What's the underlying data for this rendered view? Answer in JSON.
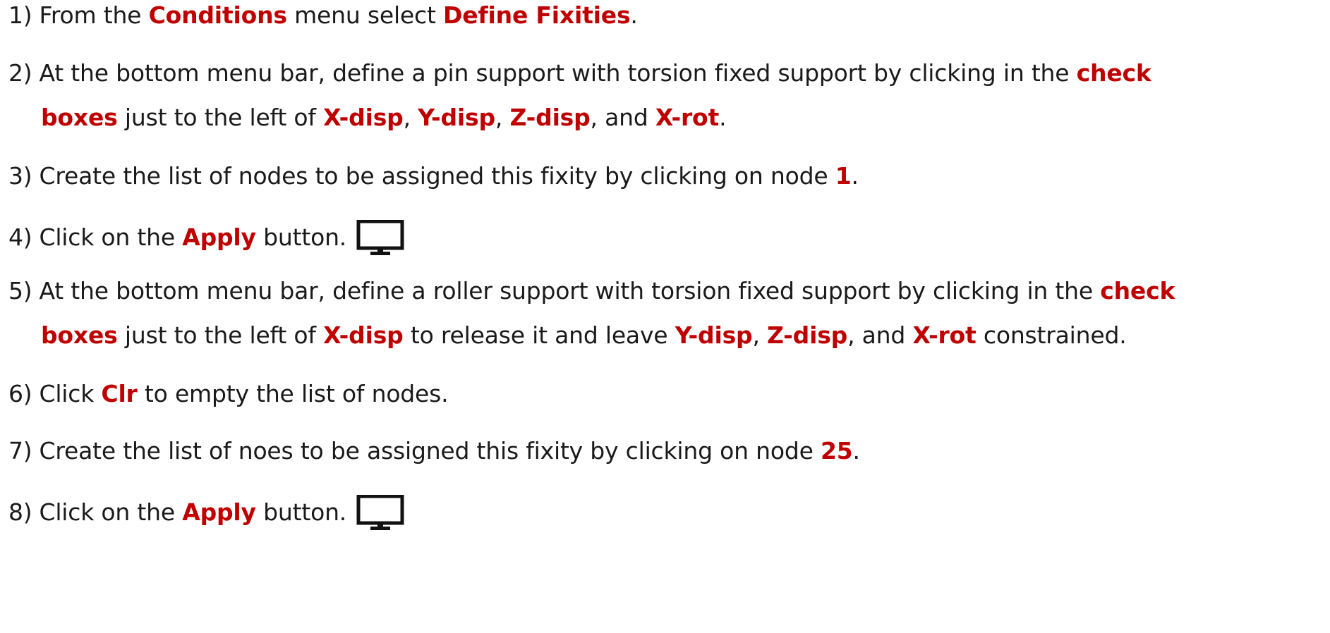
{
  "steps": [
    {
      "number": "1)",
      "segments": [
        {
          "text": "From the ",
          "highlight": false
        },
        {
          "text": "Conditions",
          "highlight": true
        },
        {
          "text": " menu select ",
          "highlight": false
        },
        {
          "text": "Define Fixities",
          "highlight": true
        },
        {
          "text": ".",
          "highlight": false
        }
      ]
    },
    {
      "number": "2)",
      "line1": [
        {
          "text": "At the bottom menu bar, define a pin support with torsion fixed support by clicking in the ",
          "highlight": false
        },
        {
          "text": "check",
          "highlight": true
        }
      ],
      "line2": [
        {
          "text": "boxes",
          "highlight": true
        },
        {
          "text": " just to the left of ",
          "highlight": false
        },
        {
          "text": "X-disp",
          "highlight": true
        },
        {
          "text": ", ",
          "highlight": false
        },
        {
          "text": "Y-disp",
          "highlight": true
        },
        {
          "text": ", ",
          "highlight": false
        },
        {
          "text": "Z-disp",
          "highlight": true
        },
        {
          "text": ", and ",
          "highlight": false
        },
        {
          "text": "X-rot",
          "highlight": true
        },
        {
          "text": ".",
          "highlight": false
        }
      ]
    },
    {
      "number": "3)",
      "segments": [
        {
          "text": "Create the list of nodes to be assigned this fixity by clicking on node ",
          "highlight": false
        },
        {
          "text": "1",
          "highlight": true
        },
        {
          "text": ".",
          "highlight": false
        }
      ]
    },
    {
      "number": "4)",
      "segments": [
        {
          "text": "Click on the ",
          "highlight": false
        },
        {
          "text": "Apply",
          "highlight": true
        },
        {
          "text": " button.",
          "highlight": false
        }
      ],
      "icon": "monitor-icon"
    },
    {
      "number": "5)",
      "line1": [
        {
          "text": "At the bottom menu bar, define a roller support with torsion fixed support by clicking in the ",
          "highlight": false
        },
        {
          "text": "check",
          "highlight": true
        }
      ],
      "line2": [
        {
          "text": "boxes",
          "highlight": true
        },
        {
          "text": " just to the left of ",
          "highlight": false
        },
        {
          "text": "X-disp",
          "highlight": true
        },
        {
          "text": " to release it and leave ",
          "highlight": false
        },
        {
          "text": "Y-disp",
          "highlight": true
        },
        {
          "text": ", ",
          "highlight": false
        },
        {
          "text": "Z-disp",
          "highlight": true
        },
        {
          "text": ", and ",
          "highlight": false
        },
        {
          "text": "X-rot",
          "highlight": true
        },
        {
          "text": " constrained.",
          "highlight": false
        }
      ]
    },
    {
      "number": "6)",
      "segments": [
        {
          "text": "Click ",
          "highlight": false
        },
        {
          "text": "Clr",
          "highlight": true
        },
        {
          "text": " to empty the list of nodes.",
          "highlight": false
        }
      ]
    },
    {
      "number": "7)",
      "segments": [
        {
          "text": "Create the list of noes to be assigned this fixity by clicking on node ",
          "highlight": false
        },
        {
          "text": "25",
          "highlight": true
        },
        {
          "text": ".",
          "highlight": false
        }
      ]
    },
    {
      "number": "8)",
      "segments": [
        {
          "text": "Click on the ",
          "highlight": false
        },
        {
          "text": "Apply",
          "highlight": true
        },
        {
          "text": " button.",
          "highlight": false
        }
      ],
      "icon": "monitor-icon"
    }
  ],
  "colors": {
    "highlight": "#c00000",
    "text": "#1a1a1a"
  }
}
